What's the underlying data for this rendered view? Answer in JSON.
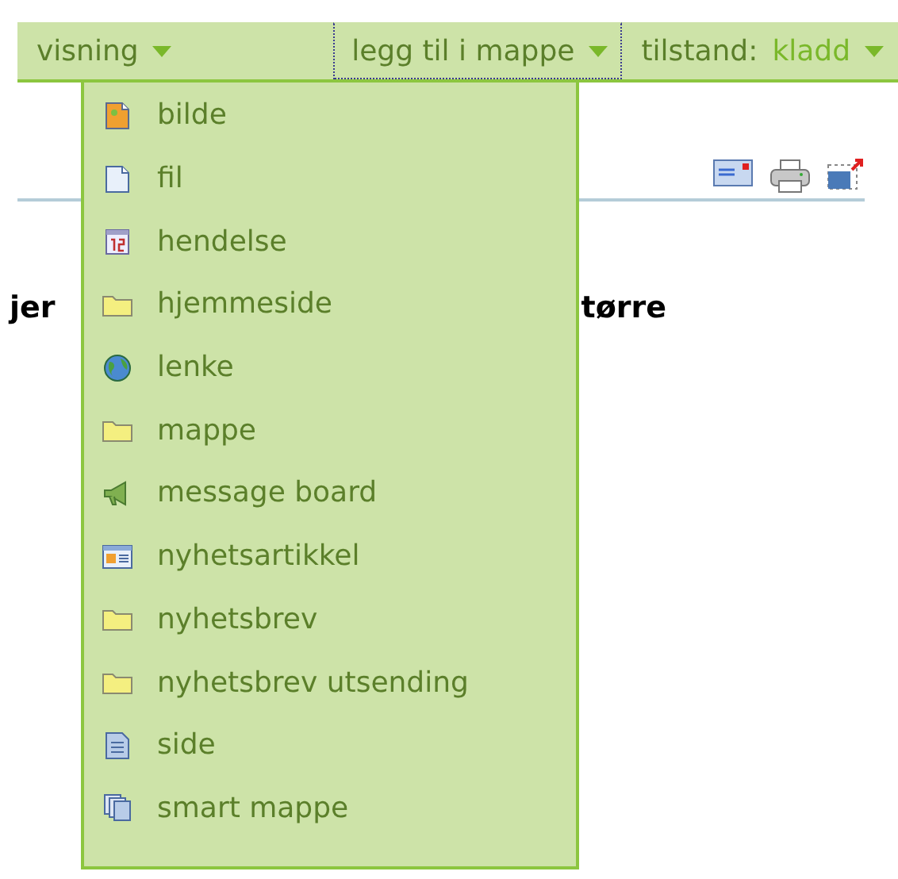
{
  "menu_bar": {
    "tabs": [
      {
        "label": "visning",
        "selected": false
      },
      {
        "label": "legg til i mappe",
        "selected": true
      },
      {
        "label": "tilstand:",
        "value": "kladd",
        "selected": false
      }
    ]
  },
  "dropdown": {
    "items": [
      {
        "label": "bilde",
        "kind": "image"
      },
      {
        "label": "fil",
        "kind": "file"
      },
      {
        "label": "hendelse",
        "kind": "event"
      },
      {
        "label": "hjemmeside",
        "kind": "folder"
      },
      {
        "label": "lenke",
        "kind": "link"
      },
      {
        "label": "mappe",
        "kind": "folder"
      },
      {
        "label": "message board",
        "kind": "board"
      },
      {
        "label": "nyhetsartikkel",
        "kind": "news"
      },
      {
        "label": "nyhetsbrev",
        "kind": "folder"
      },
      {
        "label": "nyhetsbrev utsending",
        "kind": "folder"
      },
      {
        "label": "side",
        "kind": "page"
      },
      {
        "label": "smart mappe",
        "kind": "smart"
      }
    ]
  },
  "content": {
    "heading_left": "jer",
    "heading_right": "tørre"
  }
}
